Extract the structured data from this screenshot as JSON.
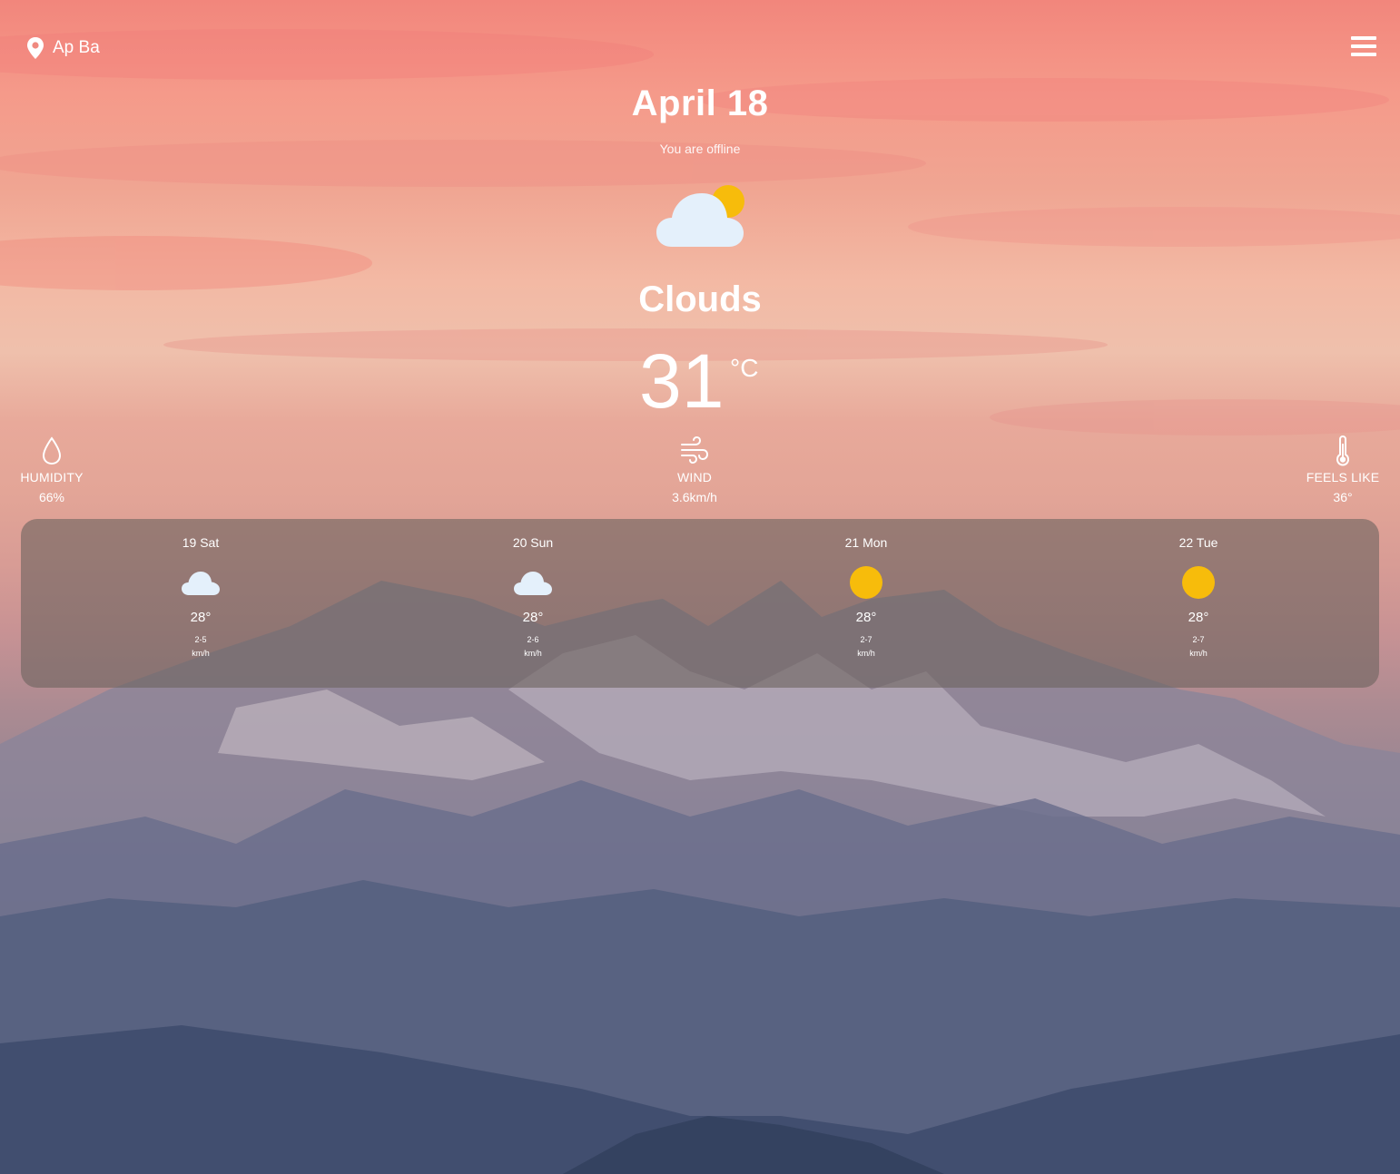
{
  "header": {
    "location": "Ap Ba",
    "menu_icon": "hamburger-menu-icon"
  },
  "current": {
    "date": "April 18",
    "status": "You are offline",
    "icon": "partly-cloudy-icon",
    "condition": "Clouds",
    "temperature": "31",
    "unit": "°C"
  },
  "stats": {
    "humidity": {
      "icon": "droplet-icon",
      "label": "HUMIDITY",
      "value": "66%"
    },
    "wind": {
      "icon": "wind-icon",
      "label": "WIND",
      "value": "3.6km/h"
    },
    "feels_like": {
      "icon": "thermometer-icon",
      "label": "FEELS LIKE",
      "value": "36°"
    }
  },
  "forecast": [
    {
      "day": "19 Sat",
      "icon": "cloud-icon",
      "temp": "28°",
      "wind": "2-5",
      "unit": "km/h"
    },
    {
      "day": "20 Sun",
      "icon": "cloud-icon",
      "temp": "28°",
      "wind": "2-6",
      "unit": "km/h"
    },
    {
      "day": "21 Mon",
      "icon": "sun-icon",
      "temp": "28°",
      "wind": "2-7",
      "unit": "km/h"
    },
    {
      "day": "22 Tue",
      "icon": "sun-icon",
      "temp": "28°",
      "wind": "2-7",
      "unit": "km/h"
    }
  ],
  "colors": {
    "sun": "#f7bc0b",
    "cloud": "#e4f0fb",
    "panel": "#6e645f"
  }
}
